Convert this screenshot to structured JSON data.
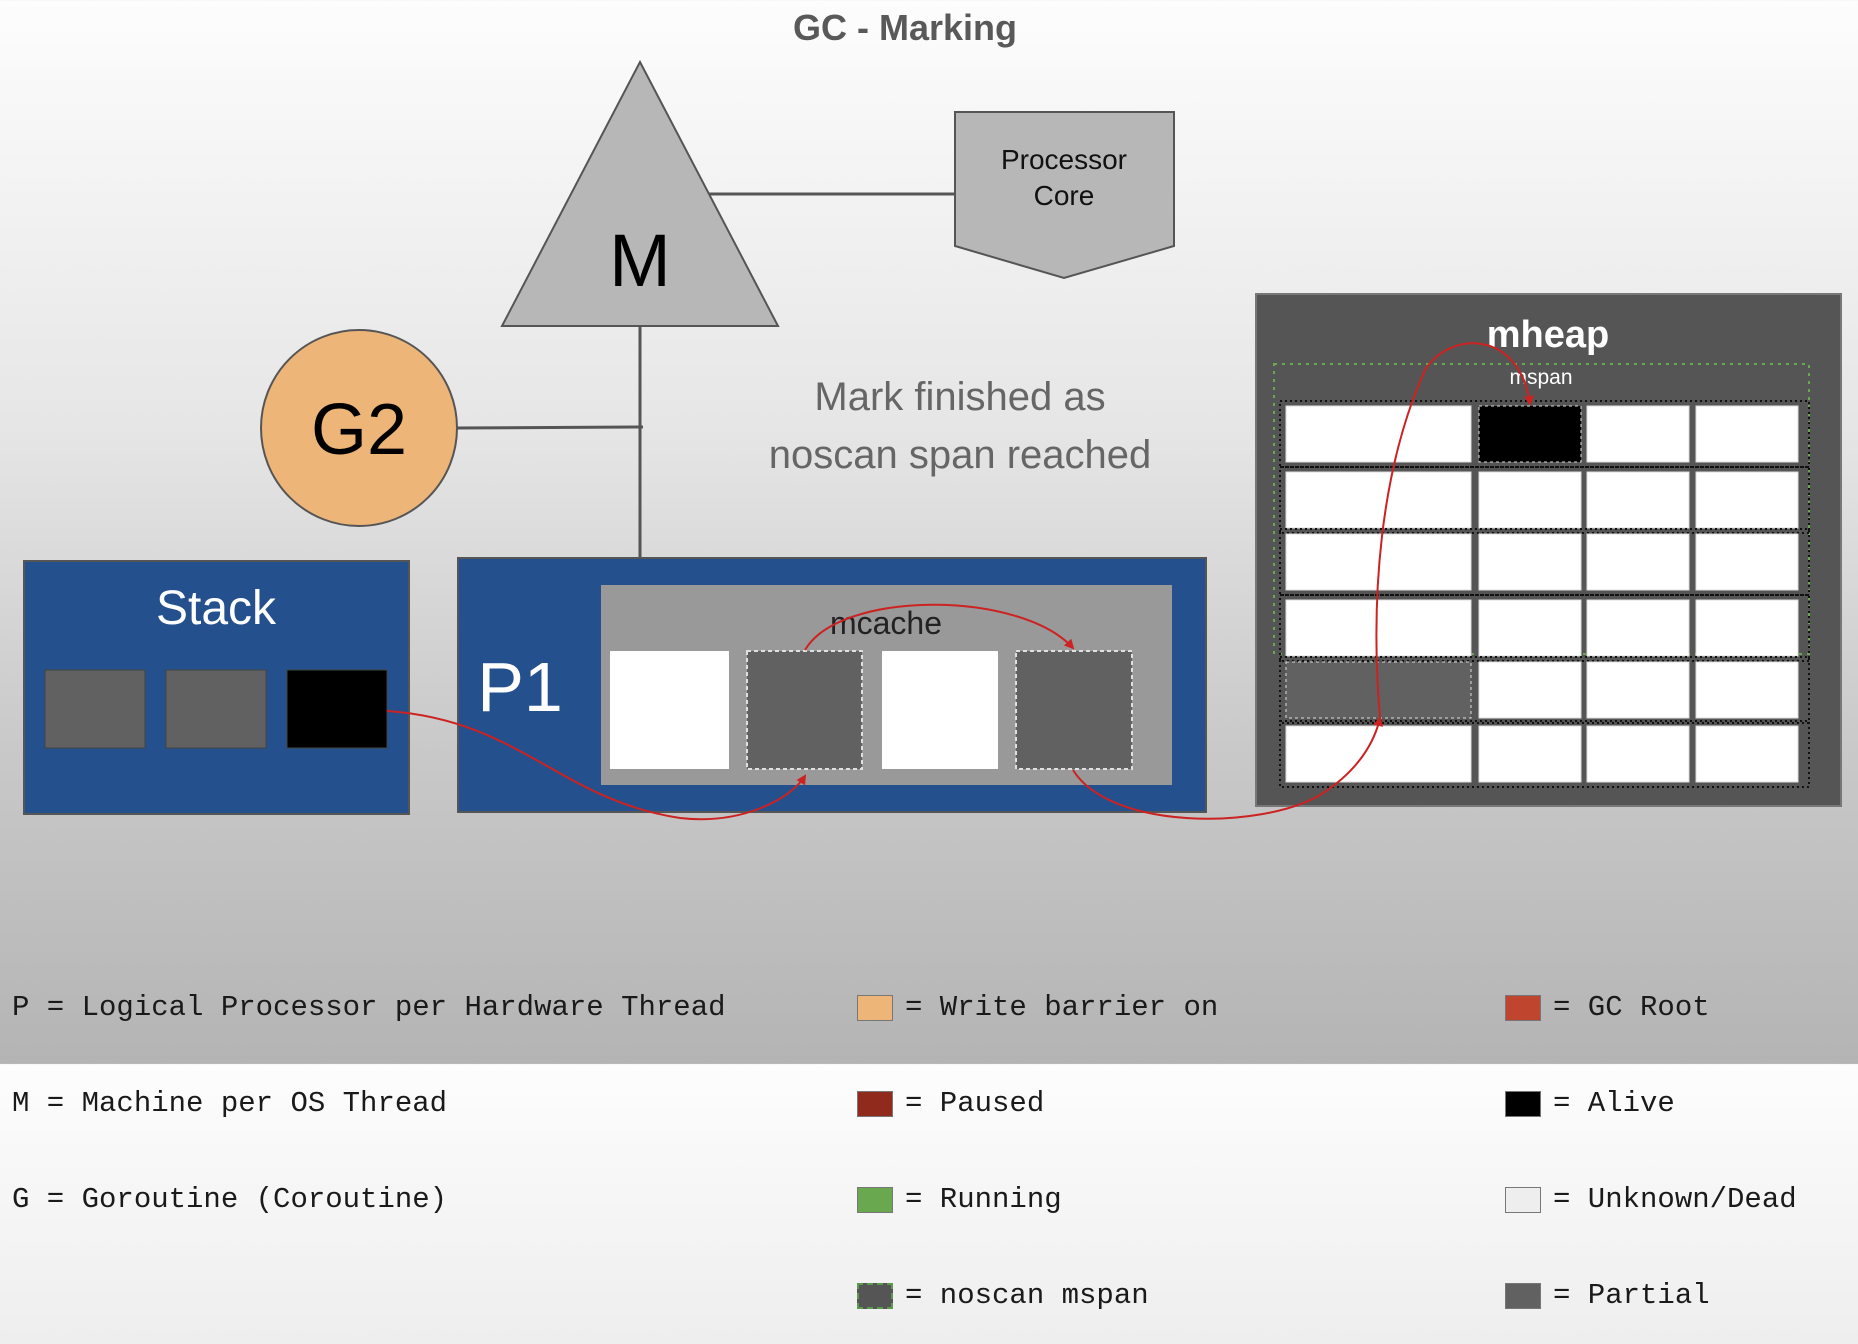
{
  "title": "GC - Marking",
  "machine": {
    "label": "M"
  },
  "processor_core": {
    "line1": "Processor",
    "line2": "Core"
  },
  "goroutine": {
    "label": "G2",
    "color": "#edb578"
  },
  "note": {
    "line1": "Mark finished as",
    "line2": "noscan span reached"
  },
  "stack": {
    "title": "Stack",
    "slots": [
      "partial",
      "partial",
      "alive"
    ]
  },
  "processor": {
    "label": "P1",
    "mcache": {
      "title": "mcache",
      "spans": [
        "unknown",
        "partial-noscan",
        "unknown",
        "partial-noscan"
      ]
    }
  },
  "mheap": {
    "title": "mheap",
    "span_label": "mspan",
    "rows": [
      [
        "unknown",
        "alive",
        "unknown",
        "unknown"
      ],
      [
        "unknown",
        "unknown",
        "unknown",
        "unknown"
      ],
      [
        "unknown",
        "unknown",
        "unknown",
        "unknown"
      ],
      [
        "unknown",
        "unknown",
        "unknown",
        "unknown"
      ],
      [
        "partial",
        "unknown",
        "unknown",
        "unknown"
      ],
      [
        "unknown",
        "unknown",
        "unknown",
        "unknown"
      ]
    ]
  },
  "colors": {
    "panel_blue": "#24508e",
    "mheap_bg": "#555555",
    "alive": "#000000",
    "unknown": "#ffffff",
    "partial": "#616161",
    "pointer": "#cc2222"
  },
  "legend": {
    "definitions": [
      "P = Logical Processor per Hardware Thread",
      "M = Machine per OS Thread",
      "G = Goroutine (Coroutine)"
    ],
    "states": [
      {
        "label": "= Write barrier on",
        "color": "#edb578"
      },
      {
        "label": "= Paused",
        "color": "#8f2a1c"
      },
      {
        "label": "= Running",
        "color": "#6aa84f"
      },
      {
        "label": "= noscan mspan",
        "color": "#555555"
      }
    ],
    "objects": [
      {
        "label": "= GC Root",
        "color": "#c0452f"
      },
      {
        "label": "= Alive",
        "color": "#000000"
      },
      {
        "label": "= Unknown/Dead",
        "color": "#eeeeee"
      },
      {
        "label": "= Partial",
        "color": "#616161"
      }
    ]
  }
}
